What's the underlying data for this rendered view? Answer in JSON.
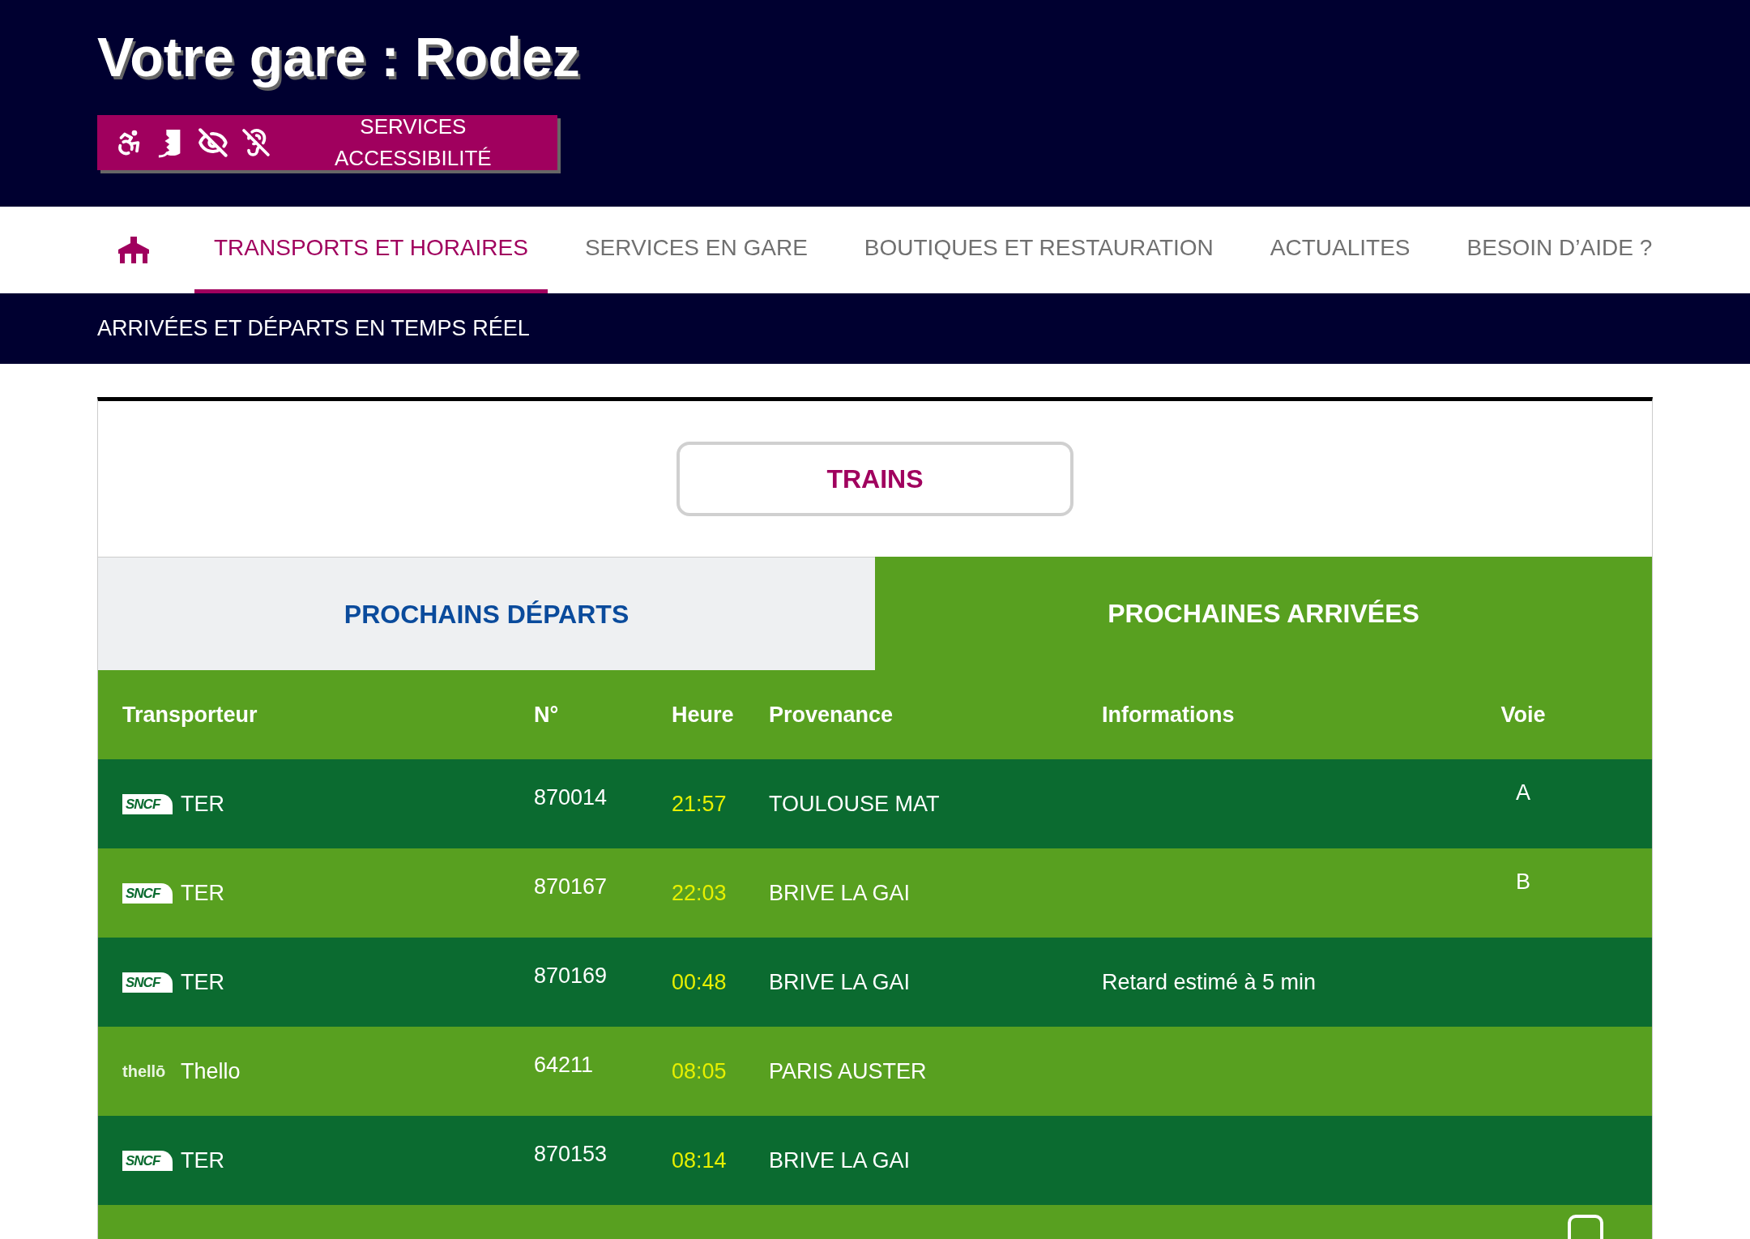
{
  "header": {
    "title": "Votre gare : Rodez",
    "accessibility_button": "SERVICES ACCESSIBILITÉ"
  },
  "nav": [
    {
      "label": "TRANSPORTS ET HORAIRES",
      "selected": true
    },
    {
      "label": "SERVICES EN GARE",
      "selected": false
    },
    {
      "label": "BOUTIQUES ET RESTAURATION",
      "selected": false
    },
    {
      "label": "ACTUALITES",
      "selected": false
    },
    {
      "label": "BESOIN D’AIDE ?",
      "selected": false
    }
  ],
  "subbar": "ARRIVÉES ET DÉPARTS EN TEMPS RÉEL",
  "mode_button": "TRAINS",
  "tabs": [
    {
      "label": "PROCHAINS DÉPARTS",
      "selected": false
    },
    {
      "label": "PROCHAINES ARRIVÉES",
      "selected": true
    }
  ],
  "table": {
    "columns": [
      "Transporteur",
      "N°",
      "Heure",
      "Provenance",
      "Informations",
      "Voie"
    ],
    "rows": [
      {
        "kind": "sncf",
        "logo": "SNCF",
        "carrier": "TER",
        "number": "870014",
        "time": "21:57",
        "origin": "TOULOUSE MAT",
        "voie": "A"
      },
      {
        "kind": "sncf",
        "logo": "SNCF",
        "carrier": "TER",
        "number": "870167",
        "time": "22:03",
        "origin": "BRIVE LA GAI",
        "voie": "B"
      },
      {
        "kind": "sncf",
        "logo": "SNCF",
        "carrier": "TER",
        "number": "870169",
        "time": "00:48",
        "origin": "BRIVE LA GAI",
        "info": "Retard estimé à 5 min"
      },
      {
        "kind": "thello",
        "logo": "thellō",
        "carrier": "Thello",
        "number": "64211",
        "time": "08:05",
        "origin": "PARIS AUSTER"
      },
      {
        "kind": "sncf",
        "logo": "SNCF",
        "carrier": "TER",
        "number": "870153",
        "time": "08:14",
        "origin": "BRIVE LA GAI"
      }
    ]
  }
}
